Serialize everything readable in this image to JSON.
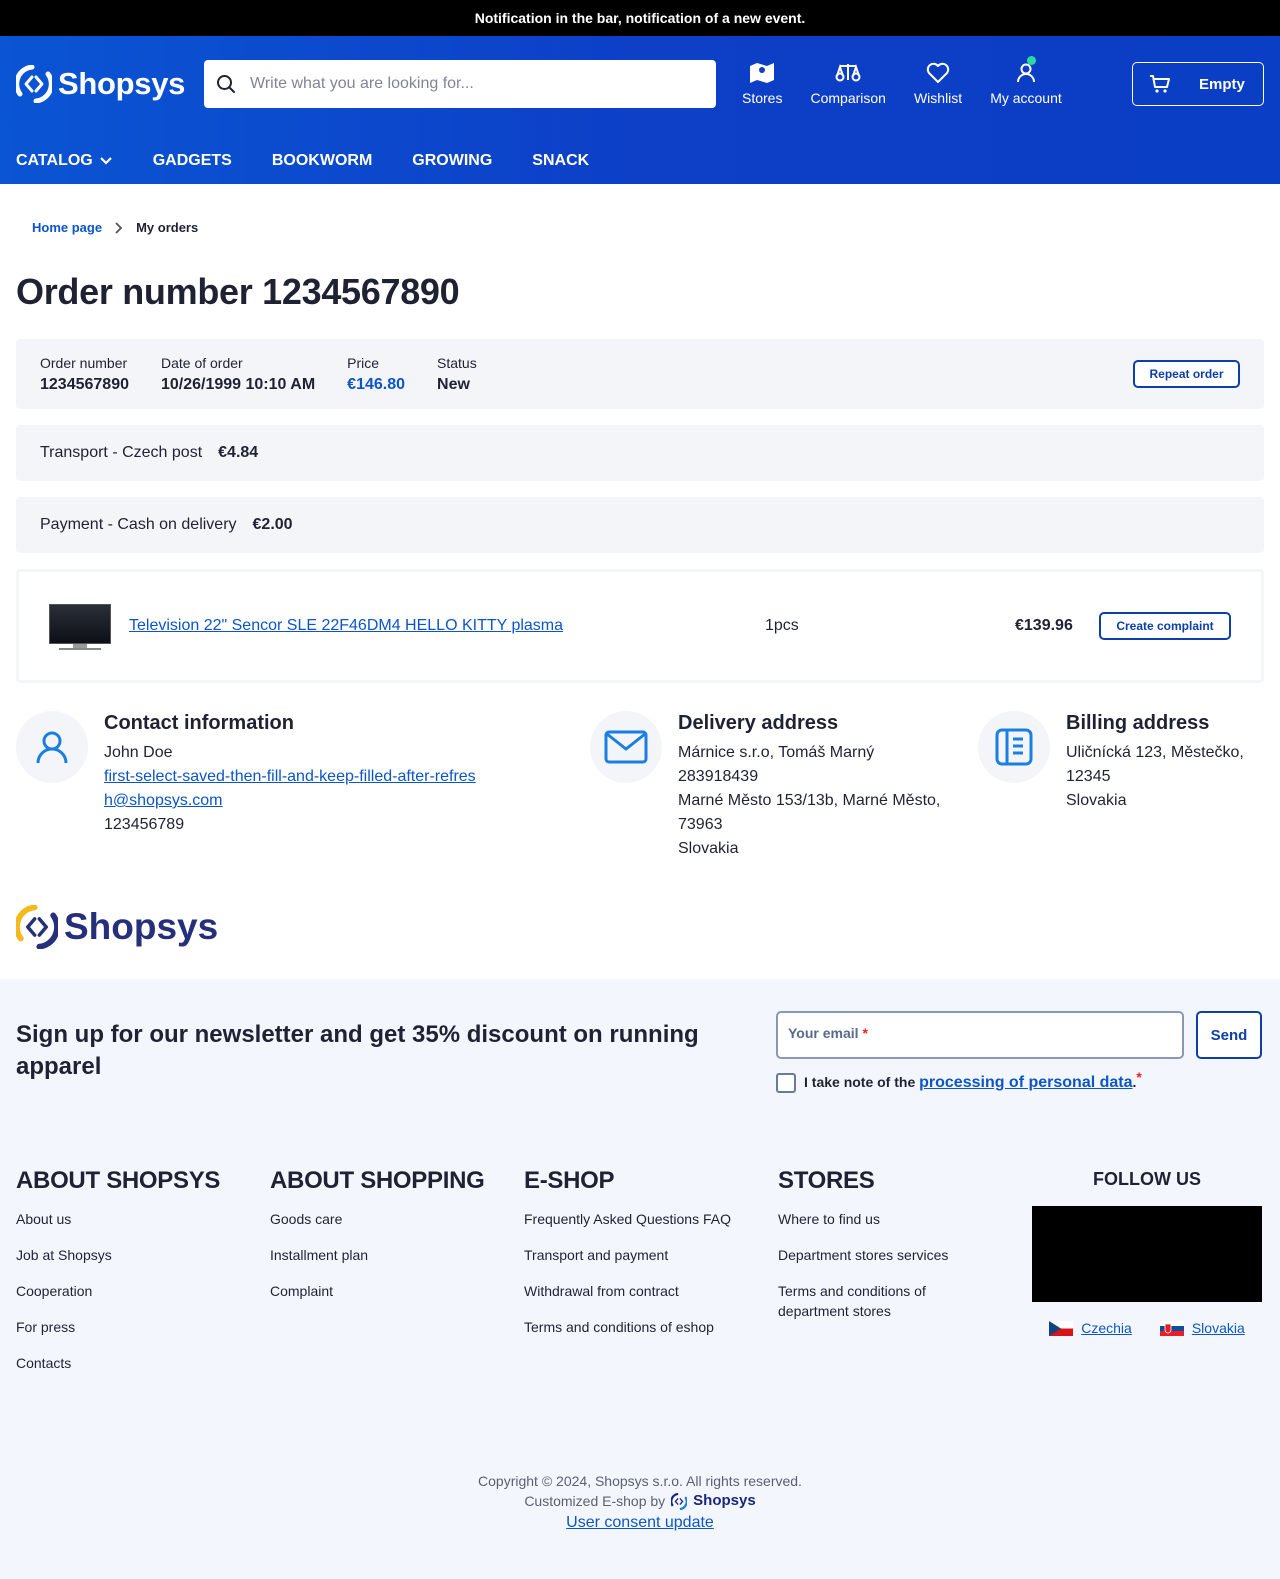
{
  "notification": "Notification in the bar, notification of a new event.",
  "header": {
    "logo": "Shopsys",
    "search_placeholder": "Write what you are looking for...",
    "nav": {
      "stores": "Stores",
      "comparison": "Comparison",
      "wishlist": "Wishlist",
      "account": "My account"
    },
    "cart": "Empty",
    "menu": [
      "CATALOG",
      "GADGETS",
      "BOOKWORM",
      "GROWING",
      "SNACK"
    ]
  },
  "breadcrumb": {
    "home": "Home page",
    "current": "My orders"
  },
  "title": "Order number 1234567890",
  "order": {
    "number_label": "Order number",
    "number": "1234567890",
    "date_label": "Date of order",
    "date": "10/26/1999 10:10 AM",
    "price_label": "Price",
    "price": "€146.80",
    "status_label": "Status",
    "status": "New",
    "repeat": "Repeat order"
  },
  "transport": {
    "label": "Transport - Czech post",
    "price": "€4.84"
  },
  "payment": {
    "label": "Payment - Cash on delivery",
    "price": "€2.00"
  },
  "item": {
    "name": "Television 22\" Sencor SLE 22F46DM4 HELLO KITTY plasma",
    "qty": "1pcs",
    "price": "€139.96",
    "complaint": "Create complaint"
  },
  "contact": {
    "title": "Contact information",
    "name": "John Doe",
    "email": "first-select-saved-then-fill-and-keep-filled-after-refresh@shopsys.com",
    "phone": "123456789"
  },
  "delivery": {
    "title": "Delivery address",
    "line1": "Márnice s.r.o, Tomáš Marný",
    "line2": "283918439",
    "line3": "Marné Město 153/13b, Marné Město, 73963",
    "line4": "Slovakia"
  },
  "billing": {
    "title": "Billing address",
    "line1": "Uličnícká 123, Městečko, 12345",
    "line2": "Slovakia"
  },
  "footer_logo": "Shopsys",
  "newsletter": {
    "title": "Sign up for our newsletter and get 35% discount on running apparel",
    "email_label": "Your email",
    "send": "Send",
    "consent_prefix": "I take note of the ",
    "consent_link": "processing of personal data",
    "consent_suffix": "."
  },
  "footer": {
    "cols": [
      {
        "title": "ABOUT SHOPSYS",
        "links": [
          "About us",
          "Job at Shopsys",
          "Cooperation",
          "For press",
          "Contacts"
        ]
      },
      {
        "title": "ABOUT SHOPPING",
        "links": [
          "Goods care",
          "Installment plan",
          "Complaint"
        ]
      },
      {
        "title": "E-SHOP",
        "links": [
          "Frequently Asked Questions FAQ",
          "Transport and payment",
          "Withdrawal from contract",
          "Terms and conditions of eshop"
        ]
      },
      {
        "title": "STORES",
        "links": [
          "Where to find us",
          "Department stores services",
          "Terms and conditions of department stores"
        ]
      }
    ],
    "follow": "FOLLOW US",
    "langs": [
      "Czechia",
      "Slovakia"
    ],
    "copyright": "Copyright © 2024, Shopsys s.r.o. All rights reserved.",
    "customized": "Customized E-shop by",
    "brand": "Shopsys",
    "consent_update": "User consent update"
  },
  "colors": {
    "accent": "#0c55c8",
    "header": "#0d3fc7",
    "footer_bg": "#f3f7fd"
  }
}
